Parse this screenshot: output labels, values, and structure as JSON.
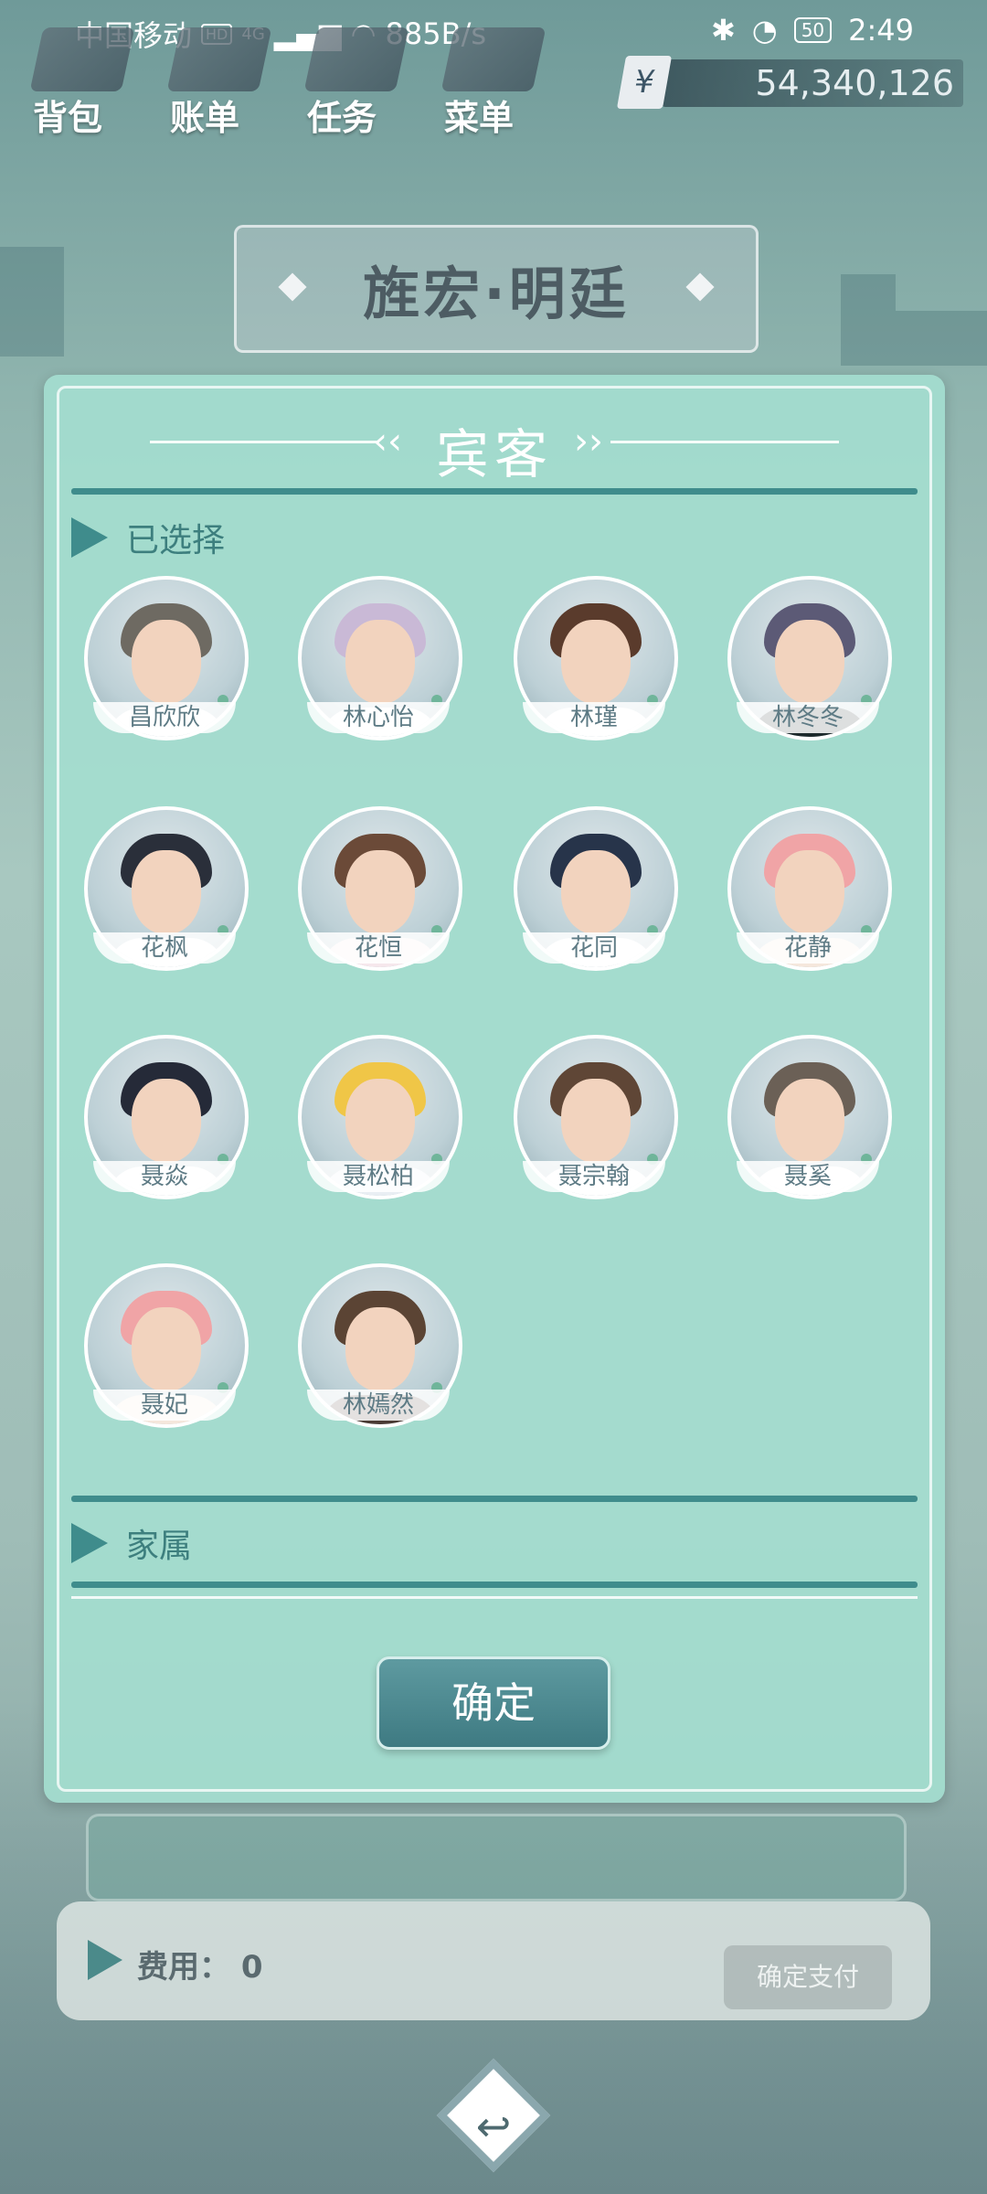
{
  "status_bar": {
    "carrier": "中国移动",
    "hd": "HD",
    "net_type": "4G",
    "speed": "885B/s",
    "battery": "50",
    "time": "2:49"
  },
  "top_menu": {
    "items": [
      {
        "label": "背包",
        "icon": "backpack-icon"
      },
      {
        "label": "账单",
        "icon": "bill-icon"
      },
      {
        "label": "任务",
        "icon": "task-icon"
      },
      {
        "label": "菜单",
        "icon": "menu-icon"
      }
    ]
  },
  "money": {
    "symbol": "¥",
    "value": "54,340,126"
  },
  "location": {
    "title": "旌宏·明廷"
  },
  "panel": {
    "title": "宾客",
    "selected_label": "已选择",
    "family_label": "家属",
    "confirm_label": "确定"
  },
  "guests": [
    {
      "name": "昌欣欣",
      "hair": "#6e6a62",
      "body": "#ffffff"
    },
    {
      "name": "林心怡",
      "hair": "#c9b9d6",
      "body": "#ffffff"
    },
    {
      "name": "林瑾",
      "hair": "#5a3b2c",
      "body": "#ffffff"
    },
    {
      "name": "林冬冬",
      "hair": "#5c5a76",
      "body": "#1d2a2c"
    },
    {
      "name": "花枫",
      "hair": "#2a2f3a",
      "body": "#ffffff"
    },
    {
      "name": "花恒",
      "hair": "#6b4a38",
      "body": "#f6e7ec"
    },
    {
      "name": "花同",
      "hair": "#27344a",
      "body": "#ffffff"
    },
    {
      "name": "花静",
      "hair": "#f0a4a6",
      "body": "#f5e7dc"
    },
    {
      "name": "聂焱",
      "hair": "#252a38",
      "body": "#ffffff"
    },
    {
      "name": "聂松柏",
      "hair": "#f0c647",
      "body": "#e9eef3"
    },
    {
      "name": "聂宗翰",
      "hair": "#5f4636",
      "body": "#ffffff"
    },
    {
      "name": "聂奚",
      "hair": "#6b6056",
      "body": "#ffffff"
    },
    {
      "name": "聂妃",
      "hair": "#f0a4a6",
      "body": "#f5e7dc"
    },
    {
      "name": "林嫣然",
      "hair": "#5b4434",
      "body": "#4a3a34"
    }
  ],
  "bottom": {
    "fee_label": "费用：",
    "fee_value": "0",
    "pay_label": "确定支付"
  }
}
